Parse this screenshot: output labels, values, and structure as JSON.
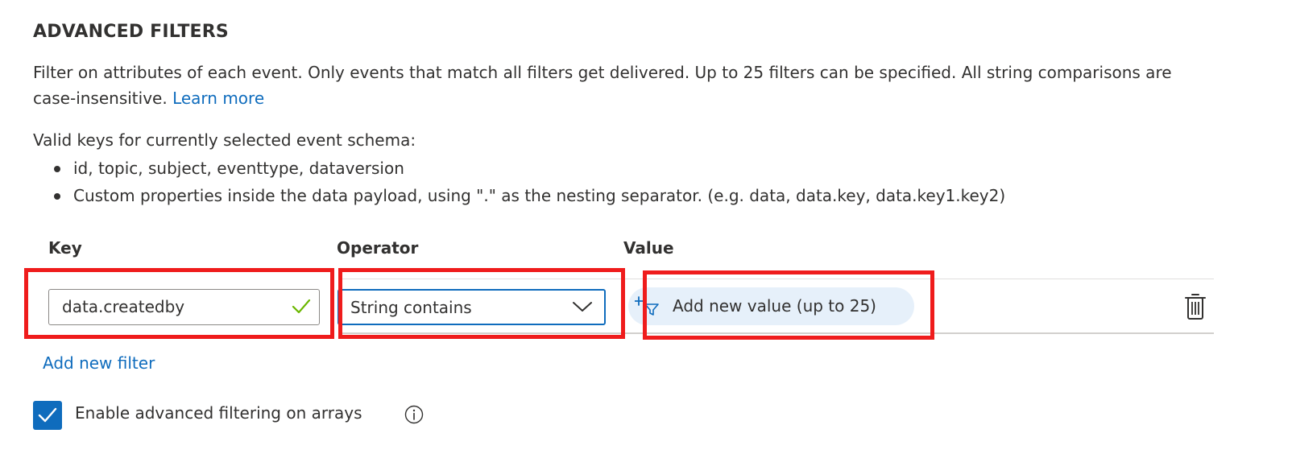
{
  "section": {
    "title": "ADVANCED FILTERS",
    "description": "Filter on attributes of each event. Only events that match all filters get delivered. Up to 25 filters can be specified. All string comparisons are case-insensitive.",
    "learn_more": "Learn more",
    "keys_intro": "Valid keys for currently selected event schema:",
    "keys": [
      "id, topic, subject, eventtype, dataversion",
      "Custom properties inside the data payload, using \".\" as the nesting separator. (e.g. data, data.key, data.key1.key2)"
    ]
  },
  "filter_table": {
    "headers": {
      "key": "Key",
      "operator": "Operator",
      "value": "Value"
    },
    "rows": [
      {
        "key": "data.createdby",
        "key_valid": true,
        "operator": "String contains",
        "value_button": "Add new value (up to 25)"
      }
    ],
    "add_filter": "Add new filter"
  },
  "arrays_option": {
    "label": "Enable advanced filtering on arrays",
    "checked": true
  },
  "icons": {
    "valid": "checkmark-icon",
    "dropdown": "chevron-down-icon",
    "add_value": "add-filter-icon",
    "delete": "trash-icon",
    "info": "info-icon"
  },
  "colors": {
    "accent": "#0f6cbd",
    "valid_check": "#6bb700",
    "highlight": "#ef1c1c",
    "pill_bg": "#e6f0fa"
  }
}
